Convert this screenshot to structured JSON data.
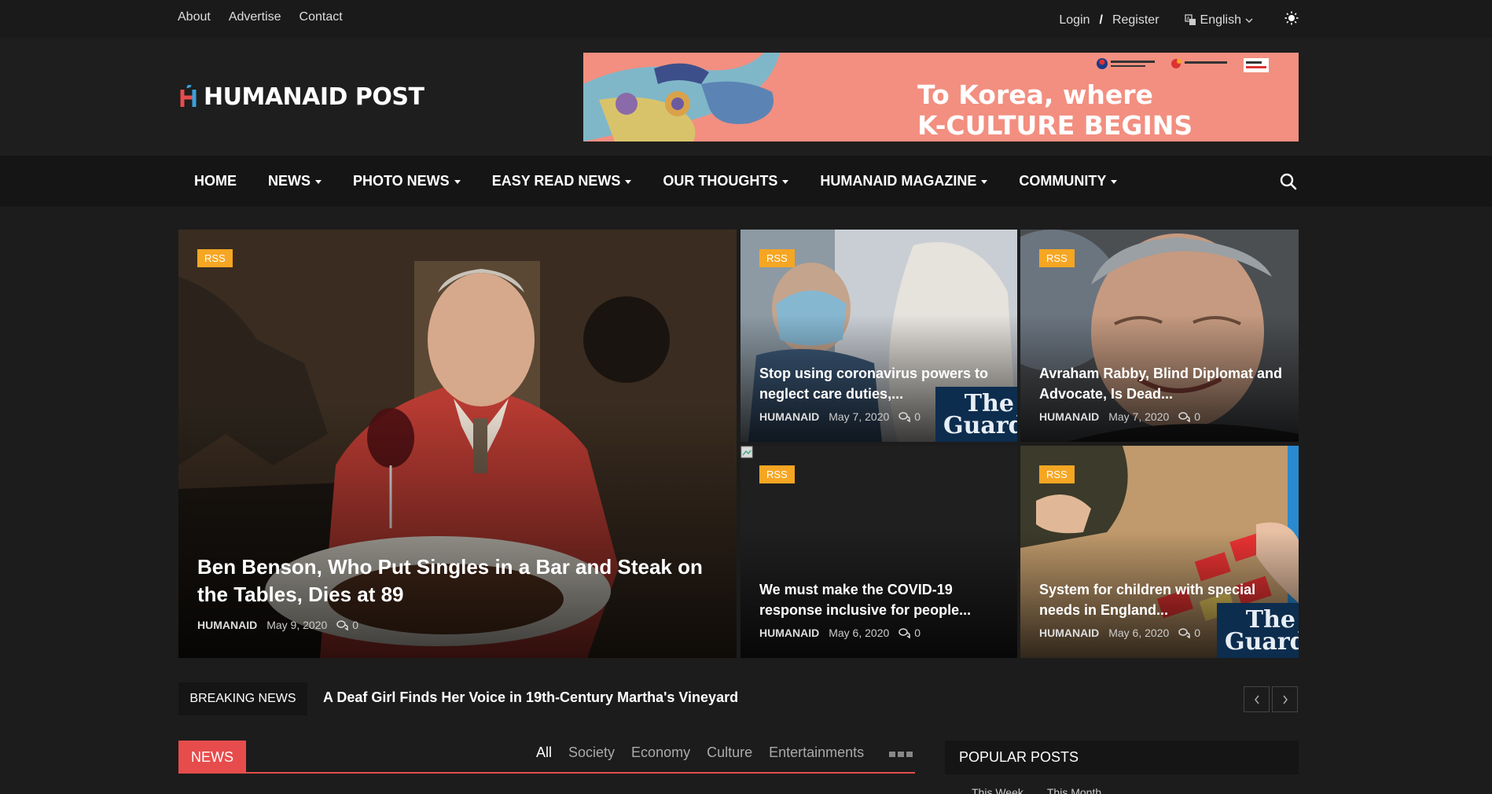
{
  "topbar": {
    "links": [
      "About",
      "Advertise",
      "Contact"
    ],
    "login": "Login",
    "separator": "/",
    "register": "Register",
    "language": "English"
  },
  "logo": {
    "text": "HUMANAID POST"
  },
  "banner": {
    "line1": "To Korea, where",
    "line2": "K-CULTURE BEGINS"
  },
  "nav": {
    "items": [
      "HOME",
      "NEWS",
      "PHOTO NEWS",
      "EASY READ NEWS",
      "OUR THOUGHTS",
      "HUMANAID MAGAZINE",
      "COMMUNITY"
    ]
  },
  "hero": {
    "main": {
      "badge": "RSS",
      "title": "Ben Benson, Who Put Singles in a Bar and Steak on the Tables, Dies at 89",
      "author": "HUMANAID",
      "date": "May 9, 2020",
      "comments": "0"
    },
    "cards": [
      {
        "badge": "RSS",
        "title": "Stop using coronavirus powers to neglect care duties,...",
        "author": "HUMANAID",
        "date": "May 7, 2020",
        "comments": "0",
        "watermark": "The Guard"
      },
      {
        "badge": "RSS",
        "title": "Avraham Rabby, Blind Diplomat and Advocate, Is Dead...",
        "author": "HUMANAID",
        "date": "May 7, 2020",
        "comments": "0"
      },
      {
        "badge": "RSS",
        "title": "We must make the COVID-19 response inclusive for people...",
        "author": "HUMANAID",
        "date": "May 6, 2020",
        "comments": "0"
      },
      {
        "badge": "RSS",
        "title": "System for children with special needs in England...",
        "author": "HUMANAID",
        "date": "May 6, 2020",
        "comments": "0",
        "watermark": "The Guard"
      }
    ]
  },
  "breaking": {
    "label": "BREAKING NEWS",
    "headline": "A Deaf Girl Finds Her Voice in 19th-Century Martha's Vineyard"
  },
  "news": {
    "label": "NEWS",
    "tabs": [
      "All",
      "Society",
      "Economy",
      "Culture",
      "Entertainments"
    ]
  },
  "popular": {
    "label": "POPULAR POSTS",
    "tabs": [
      "This Week",
      "This Month"
    ]
  },
  "colors": {
    "accent": "#e74c4c",
    "badge": "#f5a623",
    "background": "#1c1c1c"
  }
}
